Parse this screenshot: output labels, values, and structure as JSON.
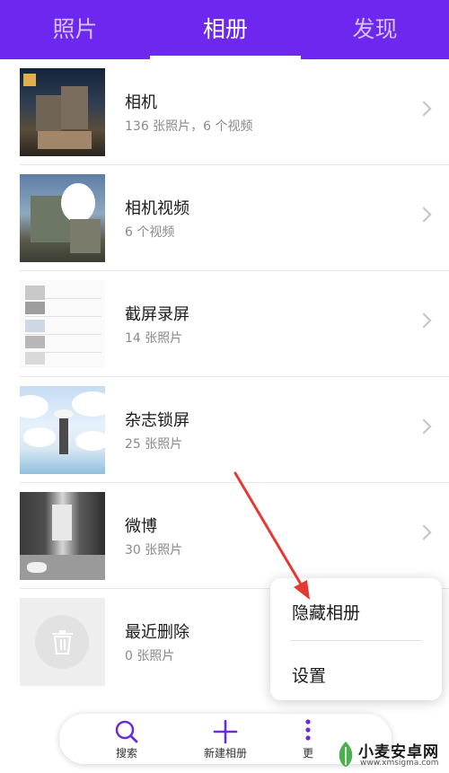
{
  "tabs": [
    {
      "label": "照片",
      "active": false
    },
    {
      "label": "相册",
      "active": true
    },
    {
      "label": "发现",
      "active": false
    }
  ],
  "albums": [
    {
      "name": "相机",
      "count": "136 张照片，6 个视频",
      "chevron": true
    },
    {
      "name": "相机视频",
      "count": "6 个视频",
      "chevron": true
    },
    {
      "name": "截屏录屏",
      "count": "14 张照片",
      "chevron": true
    },
    {
      "name": "杂志锁屏",
      "count": "25 张照片",
      "chevron": true
    },
    {
      "name": "微博",
      "count": "30 张照片",
      "chevron": true
    },
    {
      "name": "最近删除",
      "count": "0 张照片",
      "chevron": false
    }
  ],
  "toolbar": {
    "search_label": "搜索",
    "new_album_label": "新建相册",
    "more_label": "更"
  },
  "popup_menu": {
    "items": [
      "隐藏相册",
      "设置"
    ]
  },
  "watermark": {
    "title": "小麦安卓网",
    "url": "www.xmsigma.com"
  },
  "colors": {
    "accent": "#6d27ee",
    "icon_purple": "#6b2bd9",
    "annotation_arrow": "#e53935"
  }
}
